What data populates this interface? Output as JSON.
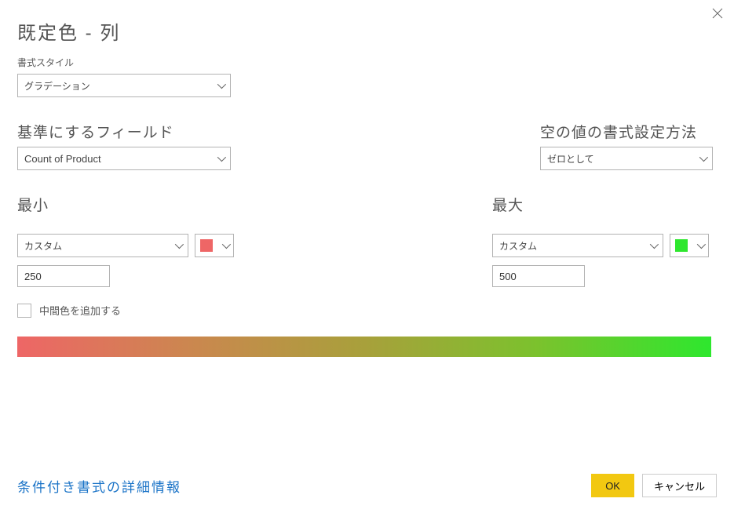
{
  "title": "既定色 -    列",
  "format_style": {
    "label": "書式スタイル",
    "value": "グラデーション"
  },
  "base_field": {
    "label": "基準にするフィールド",
    "value": "Count of Product"
  },
  "empty_format": {
    "label": "空の値の書式設定方法",
    "value": "ゼロとして"
  },
  "minimum": {
    "label": "最小",
    "type_value": "カスタム",
    "number": "250",
    "color": "#ee6666"
  },
  "maximum": {
    "label": "最大",
    "type_value": "カスタム",
    "number": "500",
    "color": "#2ee72e"
  },
  "add_middle": {
    "label": "中間色を追加する"
  },
  "footer": {
    "link": "条件付き書式の詳細情報",
    "ok": "OK",
    "cancel": "キャンセル"
  }
}
